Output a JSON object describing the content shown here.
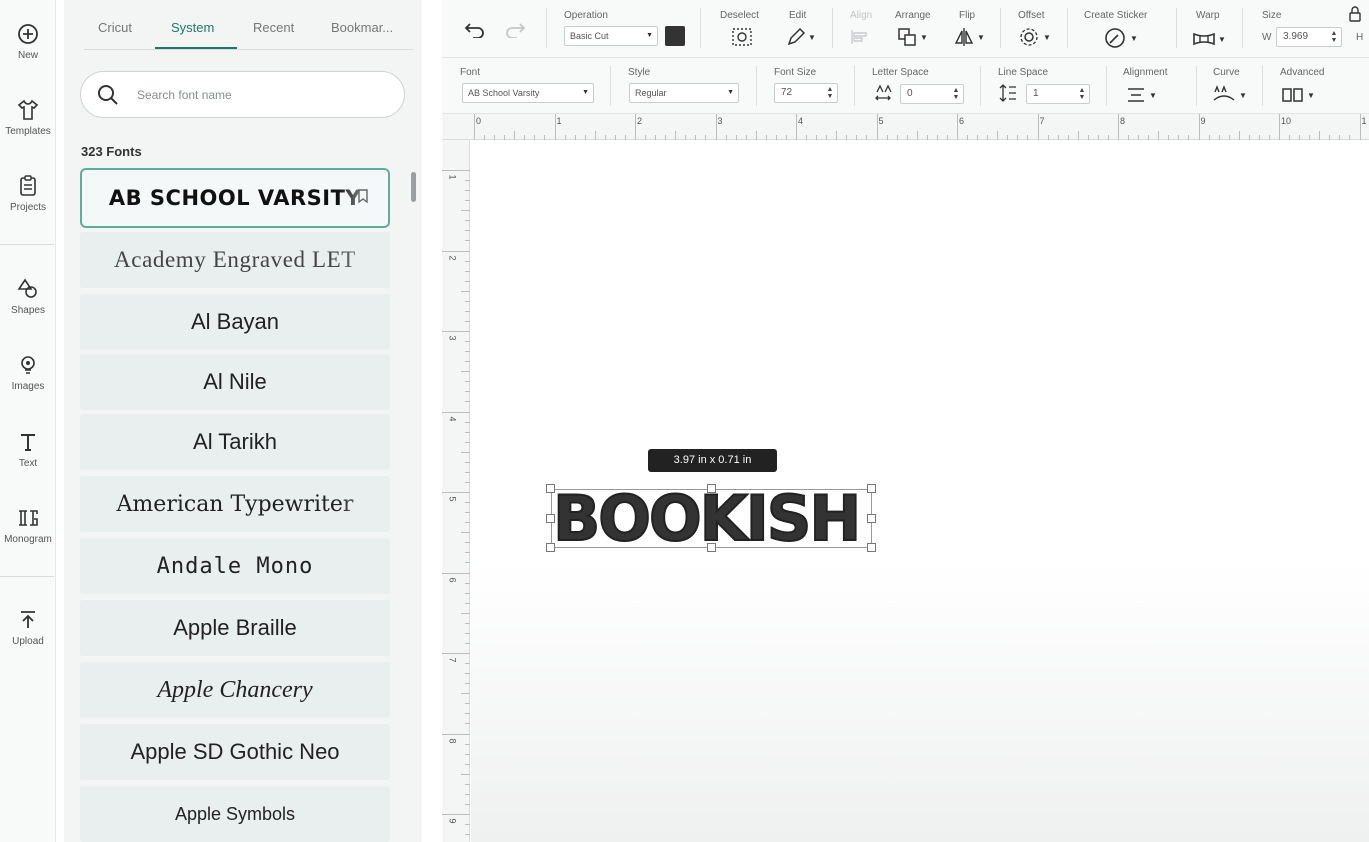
{
  "rail": {
    "items": [
      {
        "label": "New",
        "icon": "plus-circle-icon"
      },
      {
        "label": "Templates",
        "icon": "tshirt-icon"
      },
      {
        "label": "Projects",
        "icon": "clipboard-icon"
      },
      {
        "label": "Shapes",
        "icon": "shapes-icon"
      },
      {
        "label": "Images",
        "icon": "lightbulb-icon"
      },
      {
        "label": "Text",
        "icon": "text-t-icon"
      },
      {
        "label": "Monogram",
        "icon": "monogram-icon"
      },
      {
        "label": "Upload",
        "icon": "upload-icon"
      }
    ]
  },
  "panel": {
    "tabs": [
      "Cricut",
      "System",
      "Recent",
      "Bookmar..."
    ],
    "active_tab": "System",
    "search_placeholder": "Search font name",
    "font_count": "323 Fonts",
    "fonts": [
      "AB SCHOOL VARSITY",
      "Academy Engraved LET",
      "Al Bayan",
      "Al Nile",
      "Al Tarikh",
      "American Typewriter",
      "Andale Mono",
      "Apple Braille",
      "Apple Chancery",
      "Apple SD Gothic Neo",
      "Apple Symbols"
    ],
    "selected_font": "AB SCHOOL VARSITY"
  },
  "toolbar": {
    "operation_label": "Operation",
    "operation_value": "Basic Cut",
    "operation_color": "#333333",
    "deselect_label": "Deselect",
    "edit_label": "Edit",
    "align_label": "Align",
    "arrange_label": "Arrange",
    "flip_label": "Flip",
    "offset_label": "Offset",
    "create_sticker_label": "Create Sticker",
    "warp_label": "Warp",
    "size_label": "Size",
    "size_w_label": "W",
    "size_w_value": "3.969",
    "size_h_label": "H"
  },
  "text_toolbar": {
    "font_label": "Font",
    "font_value": "AB School Varsity",
    "style_label": "Style",
    "style_value": "Regular",
    "font_size_label": "Font Size",
    "font_size_value": "72",
    "letter_space_label": "Letter Space",
    "letter_space_value": "0",
    "line_space_label": "Line Space",
    "line_space_value": "1",
    "alignment_label": "Alignment",
    "curve_label": "Curve",
    "advanced_label": "Advanced"
  },
  "ruler": {
    "horizontal": [
      "0",
      "1",
      "2",
      "3",
      "4",
      "5",
      "6",
      "7",
      "8",
      "9",
      "10",
      "1"
    ],
    "vertical": [
      "1",
      "2",
      "3",
      "4",
      "5",
      "6",
      "7",
      "8",
      "9"
    ]
  },
  "canvas": {
    "dimension_badge": "3.97  in x 0.71  in",
    "text_object": "BOOKISH",
    "text_color": "#333333",
    "accent": "#1d7a68"
  }
}
